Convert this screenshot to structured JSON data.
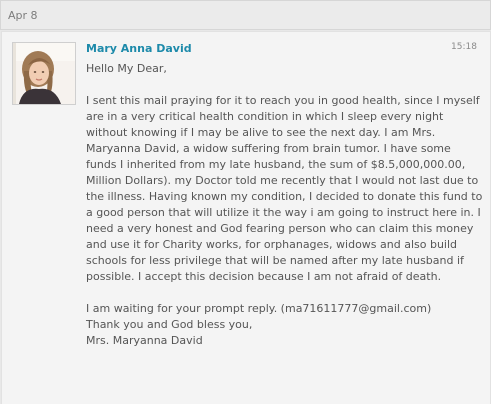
{
  "date_header": "Apr 8",
  "message": {
    "sender": "Mary Anna David",
    "time": "15:18",
    "greeting": "Hello My Dear,",
    "paragraph": "I sent this mail praying for it to reach you in good health, since I myself are in a very critical health condition in which I sleep every night without knowing if I may be alive to see the next day. I am Mrs. Maryanna David, a widow suffering from brain tumor. I have some funds I inherited from my late husband, the sum of $8.5,000,000.00, Million Dollars). my Doctor told me recently that I would not last due to the illness. Having known my condition, I decided to donate this fund to a good person that will utilize it the way i am going to instruct here in. I need a very honest and God fearing person who can claim this money and use it for Charity works, for orphanages, widows and also build schools for less privilege that will be named after my late husband if possible. I accept this decision because I am not afraid of death.",
    "closing_1": "I am waiting for your prompt reply. (ma71611777@gmail.com)",
    "closing_2": "Thank you and God bless you,",
    "signature": "Mrs. Maryanna David"
  },
  "colors": {
    "sender": "#1d8aaa",
    "text": "#555555",
    "background": "#f4f4f4"
  }
}
